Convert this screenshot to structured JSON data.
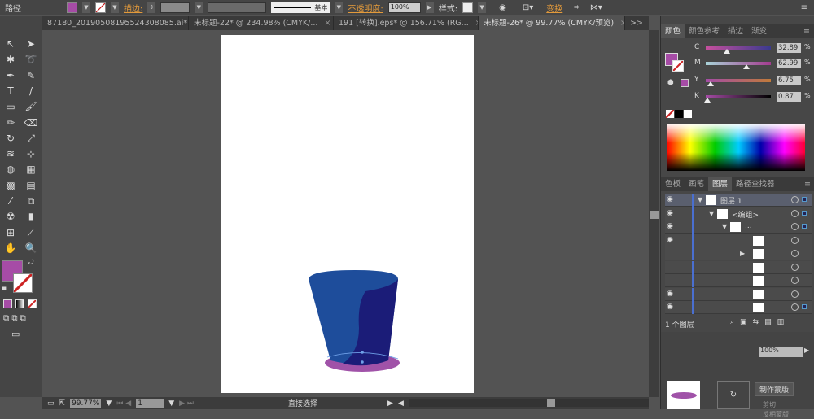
{
  "control_bar": {
    "selection_type": "路径",
    "stroke_label": "描边:",
    "stroke_profile": "基本",
    "opacity_label": "不透明度:",
    "opacity_value": "100%",
    "style_label": "样式:",
    "transform_label": "变换",
    "fill_color": "#a64ca6"
  },
  "doc_tabs": [
    {
      "label": "87180_20190508195524308085.ai*",
      "active": false
    },
    {
      "label": "未标题-22* @ 234.98% (CMYK/...",
      "active": false
    },
    {
      "label": "191 [转换].eps* @ 156.71% (RG...",
      "active": false
    },
    {
      "label": "未标题-26* @ 99.77% (CMYK/预览)",
      "active": true
    }
  ],
  "tab_overflow": ">>",
  "tools": {
    "fill_color": "#a64ca6",
    "icons": [
      "selection-tool",
      "direct-selection-tool",
      "magic-wand-tool",
      "lasso-tool",
      "pen-tool",
      "curvature-tool",
      "type-tool",
      "line-tool",
      "rectangle-tool",
      "paintbrush-tool",
      "pencil-tool",
      "eraser-tool",
      "rotate-tool",
      "scale-tool",
      "warp-tool",
      "free-transform-tool",
      "shape-builder-tool",
      "graph-tool",
      "mesh-tool",
      "gradient-tool",
      "eyedropper-tool",
      "blend-tool",
      "symbol-sprayer-tool",
      "column-graph-tool",
      "artboard-tool",
      "slice-tool",
      "hand-tool",
      "zoom-tool"
    ]
  },
  "color_panel": {
    "tabs": [
      "颜色",
      "颜色参考",
      "描边",
      "渐变"
    ],
    "sliders": [
      {
        "label": "C",
        "value": "32.89",
        "pct": "%",
        "position": 0.33
      },
      {
        "label": "M",
        "value": "62.99",
        "pct": "%",
        "position": 0.63
      },
      {
        "label": "Y",
        "value": "6.75",
        "pct": "%",
        "position": 0.07
      },
      {
        "label": "K",
        "value": "0.87",
        "pct": "%",
        "position": 0.01
      }
    ]
  },
  "layers_panel": {
    "tabs": [
      "色板",
      "画笔",
      "图层",
      "路径查找器"
    ],
    "rows": [
      {
        "name": "图层 1",
        "visible": true
      },
      {
        "name": "<编组>",
        "visible": true
      },
      {
        "name": "...",
        "visible": true
      },
      {
        "name": "",
        "visible": true
      },
      {
        "name": "",
        "visible": false
      },
      {
        "name": "",
        "visible": false
      },
      {
        "name": "",
        "visible": false
      },
      {
        "name": "",
        "visible": true
      },
      {
        "name": "",
        "visible": true
      }
    ],
    "footer": "1 个图层"
  },
  "transparency_panel": {
    "opacity": "100%",
    "make_mask": "制作蒙版",
    "clip": "剪切",
    "invert_mask": "反相蒙版"
  },
  "status_bar": {
    "zoom": "99.77%",
    "page": "1",
    "tool": "直接选择"
  },
  "artwork": {
    "cup_light": "#1e4d9b",
    "cup_dark": "#1b1c78",
    "shadow": "#a052a8"
  }
}
